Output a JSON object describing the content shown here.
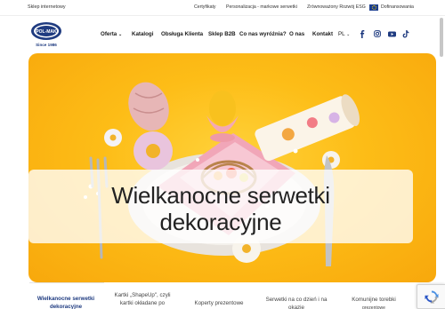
{
  "topbar": {
    "shop_link": "Sklep internetowy",
    "links": [
      "Certyfikaty",
      "Personalizacja - markowe serwetki",
      "Zrównoważony Rozwój ESG"
    ],
    "funding_link": "Dofinansowania"
  },
  "header": {
    "logo": {
      "brand": "POL-MAK",
      "since": "Since 1986"
    },
    "nav": [
      {
        "label": "Oferta",
        "has_dropdown": true
      },
      {
        "label": "Katalogi"
      },
      {
        "label": "Obsługa Klienta"
      },
      {
        "label": "Sklep B2B"
      },
      {
        "label": "Co nas wyróżnia?"
      },
      {
        "label": "O nas"
      },
      {
        "label": "Kontakt"
      }
    ],
    "language": "PL",
    "social_icons": [
      "facebook-icon",
      "instagram-icon",
      "youtube-icon",
      "tiktok-icon"
    ]
  },
  "hero": {
    "title_line1": "Wielkanocne serwetki",
    "title_line2": "dekoracyjne"
  },
  "tabs": [
    {
      "line1": "Wielkanocne serwetki",
      "line2": "dekoracyjne",
      "active": true
    },
    {
      "line1": "Kartki „ShapeUp\", czyli",
      "line2": "kartki okładane po",
      "active": false
    },
    {
      "line1": "",
      "line2": "Koperty prezentowe",
      "active": false
    },
    {
      "line1": "Serwetki na co dzień i na",
      "line2": "okazje",
      "active": false
    },
    {
      "line1": "Komunijne torebki",
      "line2": "prezentowe",
      "active": false
    }
  ],
  "colors": {
    "brand_blue": "#1f3b80",
    "hero_yellow": "#fdbd17",
    "eu_blue": "#1d3f8f"
  }
}
